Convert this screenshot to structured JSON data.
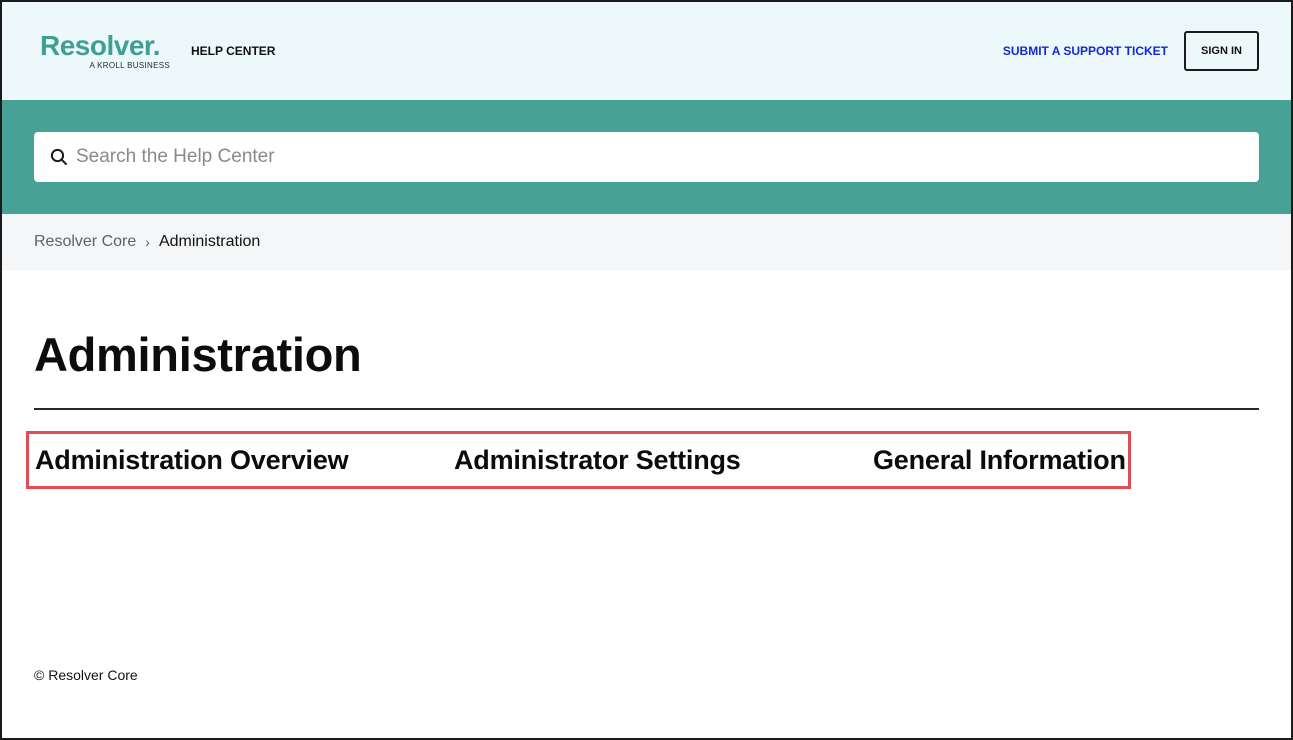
{
  "header": {
    "logo_text": "Resolver.",
    "logo_subtext": "A KROLL BUSINESS",
    "help_center_label": "HELP CENTER",
    "submit_ticket_label": "SUBMIT A SUPPORT TICKET",
    "sign_in_label": "SIGN IN",
    "brand_color": "#3f9f94",
    "link_color": "#1428d6"
  },
  "search": {
    "placeholder": "Search the Help Center",
    "value": "",
    "band_color": "#47a195",
    "icon": "search-icon"
  },
  "breadcrumb": {
    "items": [
      {
        "label": "Resolver Core"
      },
      {
        "label": "Administration"
      }
    ],
    "separator": "›"
  },
  "main": {
    "title": "Administration",
    "sections": [
      {
        "label": "Administration Overview"
      },
      {
        "label": "Administrator Settings"
      },
      {
        "label": "General Information"
      }
    ],
    "highlight_color": "#e04d54"
  },
  "footer": {
    "text": "© Resolver Core"
  }
}
